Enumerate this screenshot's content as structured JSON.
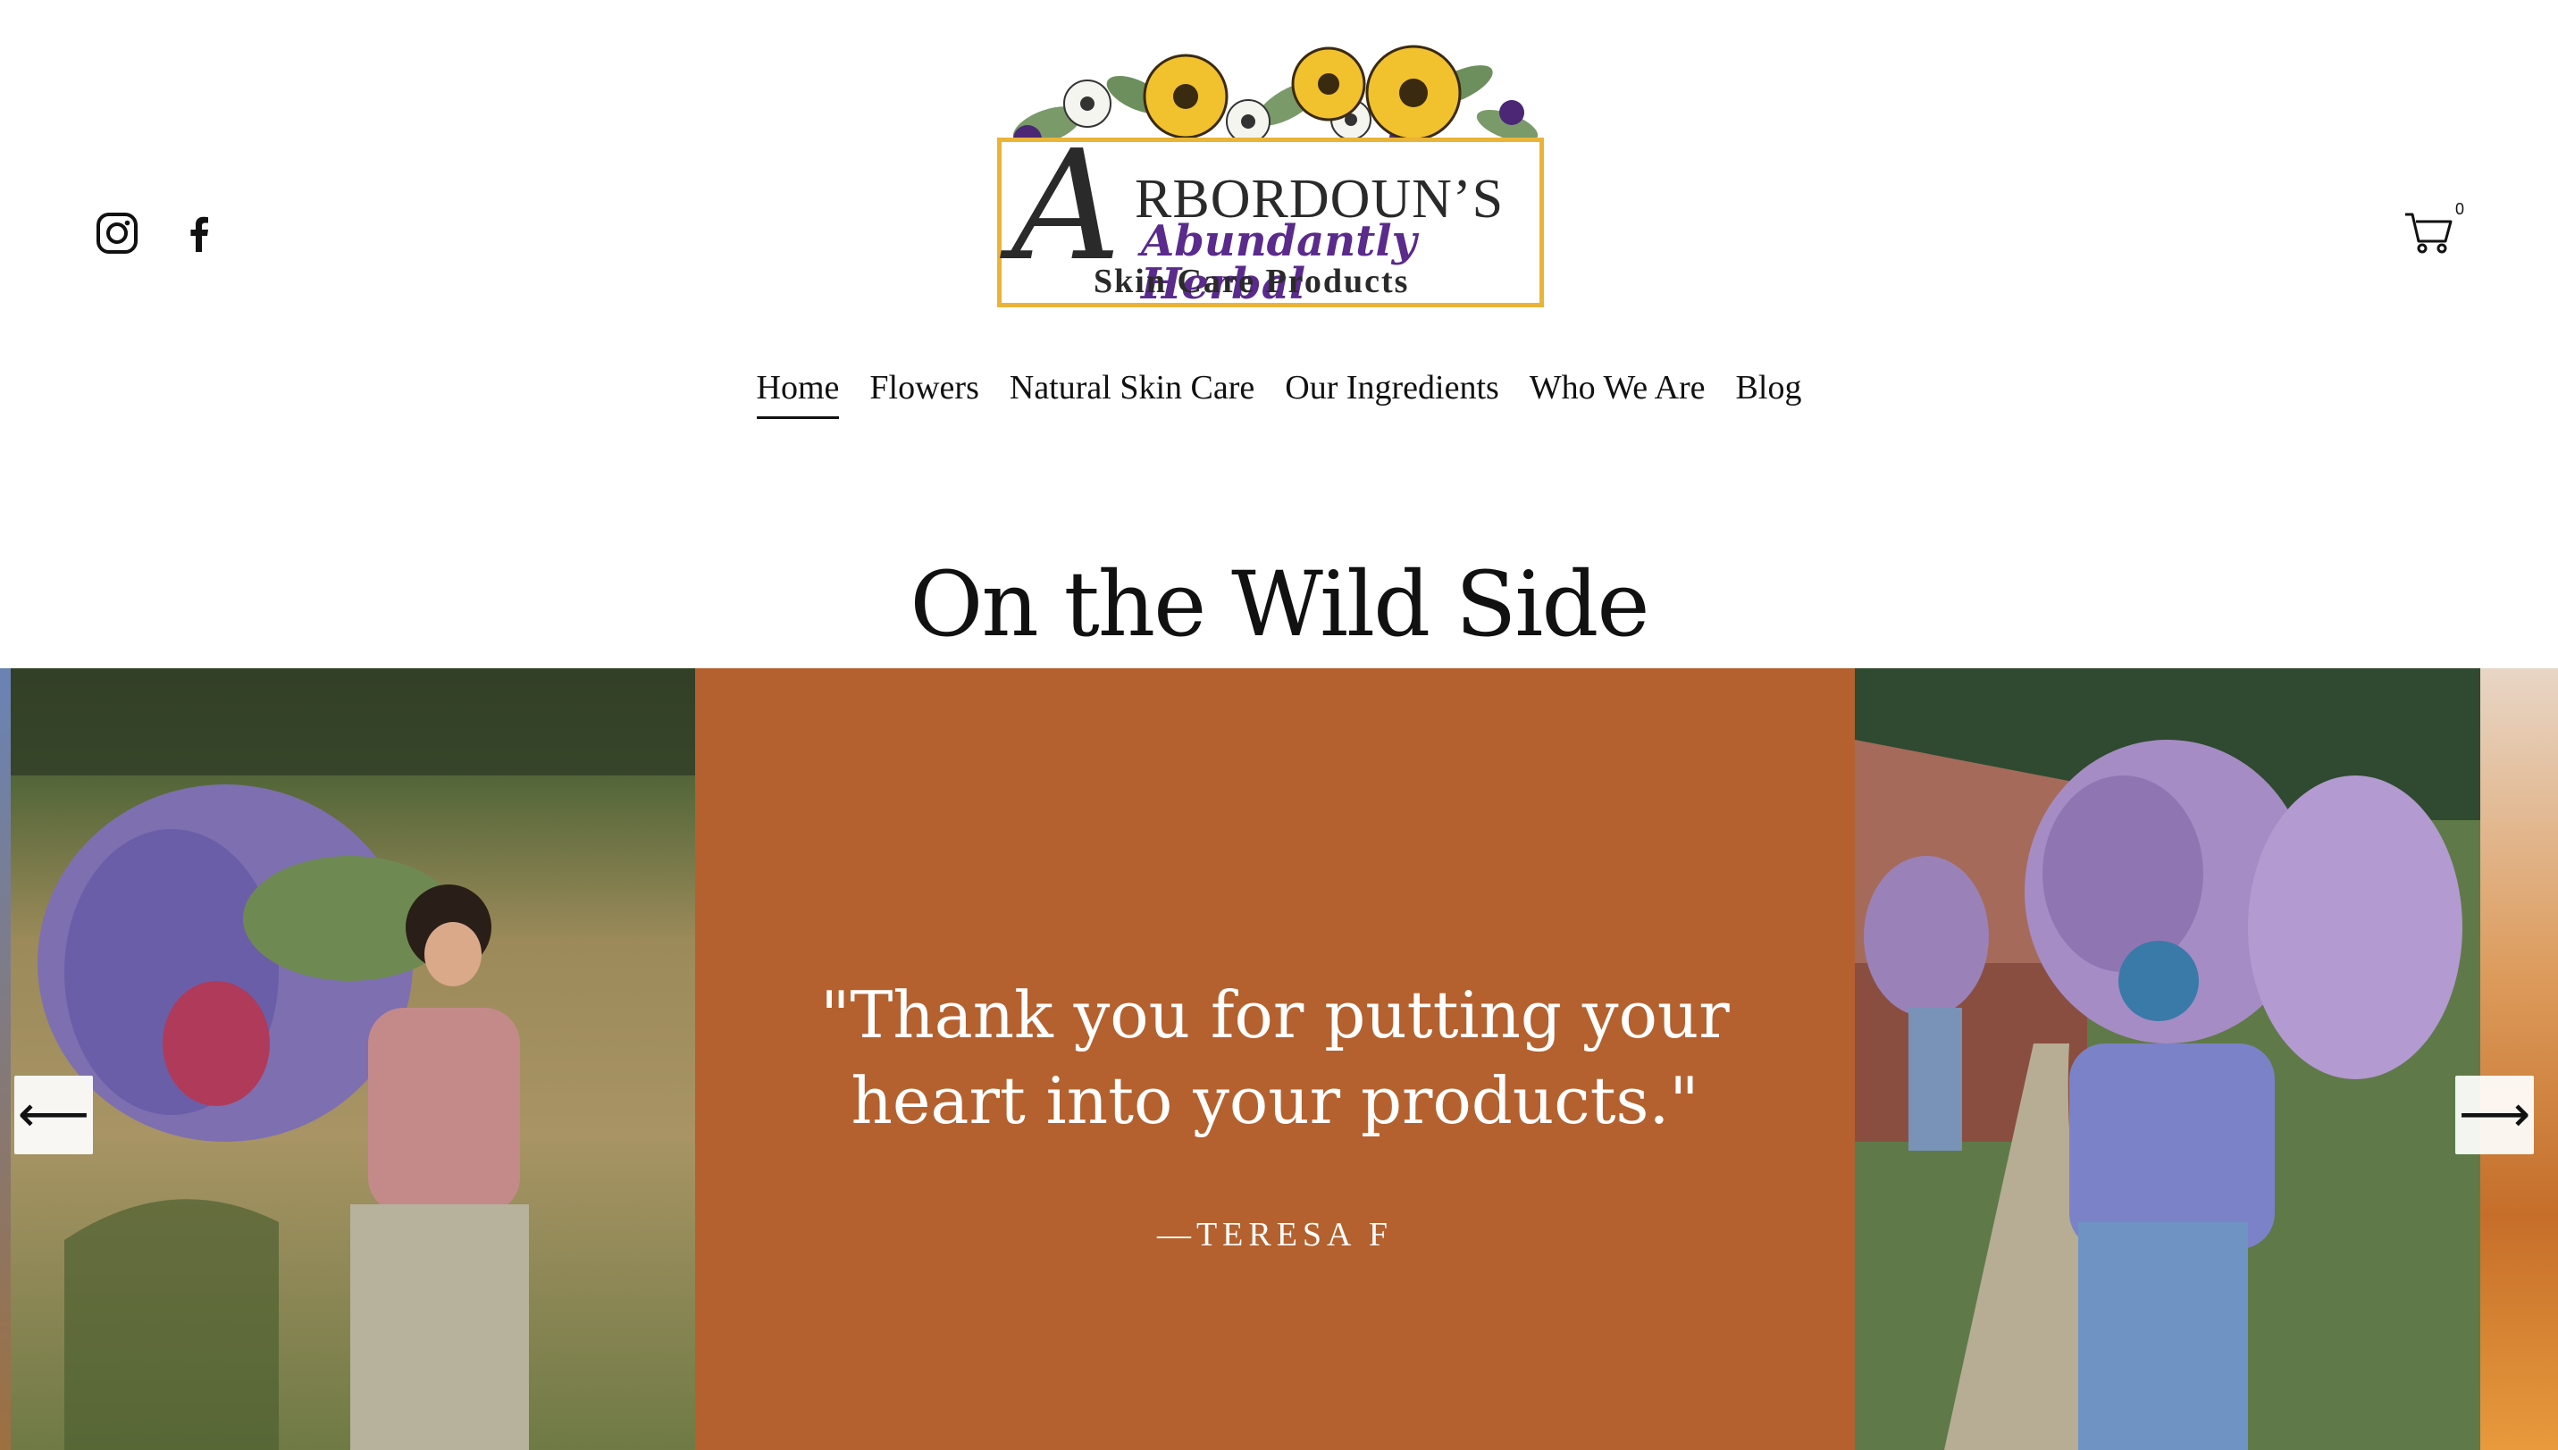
{
  "header": {
    "logo": {
      "initial": "A",
      "name_rest": "RBORDOUN’S",
      "tagline": "Abundantly Herbal",
      "subtitle": "Skin Care Products",
      "colors": {
        "frame": "#e9b437",
        "script": "#5a2a8c",
        "petals": "#f2c12e"
      }
    },
    "social": [
      {
        "icon": "instagram-icon"
      },
      {
        "icon": "facebook-icon"
      }
    ],
    "cart": {
      "icon": "cart-icon",
      "count": "0"
    }
  },
  "nav": {
    "items": [
      {
        "label": "Home",
        "active": true
      },
      {
        "label": "Flowers"
      },
      {
        "label": "Natural Skin Care"
      },
      {
        "label": "Our Ingredients"
      },
      {
        "label": "Who We Are"
      },
      {
        "label": "Blog"
      }
    ]
  },
  "main": {
    "headline": "On the Wild Side",
    "carousel": {
      "quote": "\"Thank you for putting your heart into your products.\"",
      "author": "—TERESA F",
      "prev_label": "⟵",
      "next_label": "⟶",
      "quote_bg": "#b4612f"
    }
  }
}
